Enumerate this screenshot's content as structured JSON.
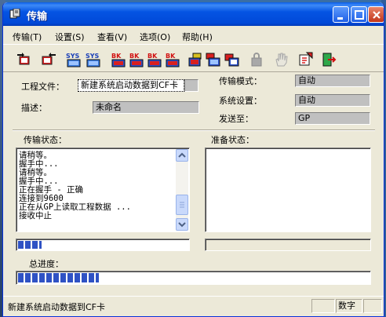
{
  "window": {
    "title": "传输"
  },
  "menu": [
    "传输(T)",
    "设置(S)",
    "查看(V)",
    "选项(O)",
    "帮助(H)"
  ],
  "toolbar": {
    "sys1": "SYS",
    "sys2": "SYS",
    "bk": [
      "BK",
      "BK",
      "BK",
      "BK"
    ]
  },
  "form": {
    "project_label": "工程文件：",
    "project_value": "新建系统启动数据到CF卡",
    "desc_label": "描述：",
    "desc_value": "未命名",
    "mode_label": "传输模式：",
    "mode_value": "自动",
    "sys_label": "系统设置：",
    "sys_value": "自动",
    "send_label": "发送至：",
    "send_value": "GP"
  },
  "transfer_status": {
    "label": "传输状态：",
    "lines": [
      "请稍等。",
      "握手中...",
      "请稍等。",
      "握手中...",
      "正在握手 - 正确",
      "连接到9600",
      "正在从GP上读取工程数据 ...",
      "接收中止"
    ]
  },
  "prepare_status": {
    "label": "准备状态："
  },
  "progress": {
    "item_fraction": 0.14,
    "total_label": "总进度：",
    "total_fraction": 0.23
  },
  "statusbar": {
    "message": "新建系统启动数据到CF卡",
    "mode": "数字"
  }
}
